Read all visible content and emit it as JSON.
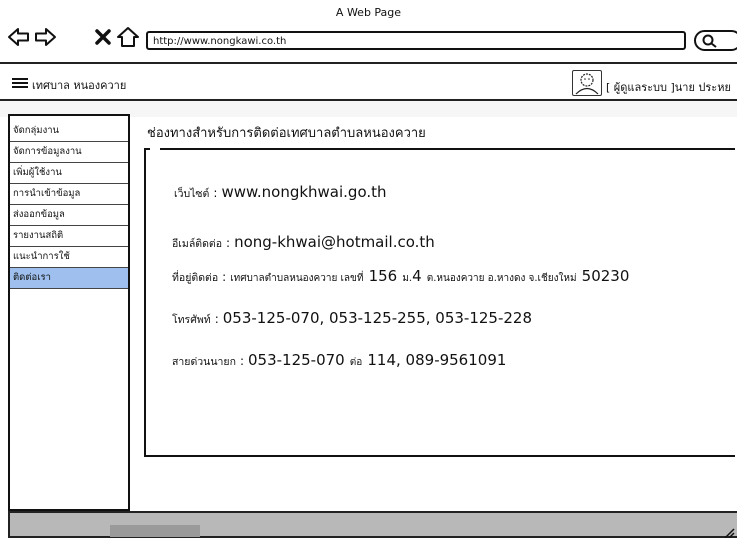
{
  "window": {
    "title": "A Web Page"
  },
  "browser": {
    "url": "http://www.nongkawi.co.th"
  },
  "header": {
    "brand": "เทศบาล  หนองควาย",
    "user_text": "[ ผู้ดูแลระบบ ]นาย ประหย"
  },
  "sidebar": {
    "items": [
      {
        "label": "จัดกลุ่มงาน",
        "active": false
      },
      {
        "label": "จัดการข้อมูลงาน",
        "active": false
      },
      {
        "label": "เพิ่มผู้ใช้งาน",
        "active": false
      },
      {
        "label": "การนำเข้าข้อมูล",
        "active": false
      },
      {
        "label": "ส่งออกข้อมูล",
        "active": false
      },
      {
        "label": "รายงานสถิติ",
        "active": false
      },
      {
        "label": "แนะนำการใช้",
        "active": false
      },
      {
        "label": "ติดต่อเรา",
        "active": true
      }
    ]
  },
  "main": {
    "title": "ช่องทางสำหรับการติดต่อเทศบาลตำบลหนองควาย",
    "website": {
      "label": "เว็บไซต์",
      "sep": ":",
      "value": "www.nongkhwai.go.th"
    },
    "email": {
      "label": "อีเมล์ติดต่อ",
      "sep": ":",
      "value": "nong-khwai@hotmail.co.th"
    },
    "address": {
      "label": "ที่อยู่ติดต่อ",
      "sep": ":",
      "part1": "เทศบาลตำบลหนองควาย เลขที่",
      "house_no": "156",
      "part2": "ม.",
      "moo": "4",
      "part3": "ต.หนองควาย อ.หางดง จ.เชียงใหม่",
      "postcode": "50230"
    },
    "phone": {
      "label": "โทรศัพท์",
      "sep": ":",
      "value": "053-125-070, 053-125-255, 053-125-228"
    },
    "hotline": {
      "label": "สายด่วนนายก",
      "sep": ":",
      "value1": "053-125-070",
      "ext_label": "ต่อ",
      "value2": "114, 089-9561091"
    }
  },
  "colors": {
    "active_item": "#9fc0ee",
    "footer": "#b8b8b8",
    "border": "#111111"
  },
  "icons": [
    "back-arrow-icon",
    "forward-arrow-icon",
    "close-icon",
    "home-icon",
    "search-icon",
    "hamburger-menu-icon",
    "user-avatar-icon",
    "resize-grip-icon"
  ]
}
